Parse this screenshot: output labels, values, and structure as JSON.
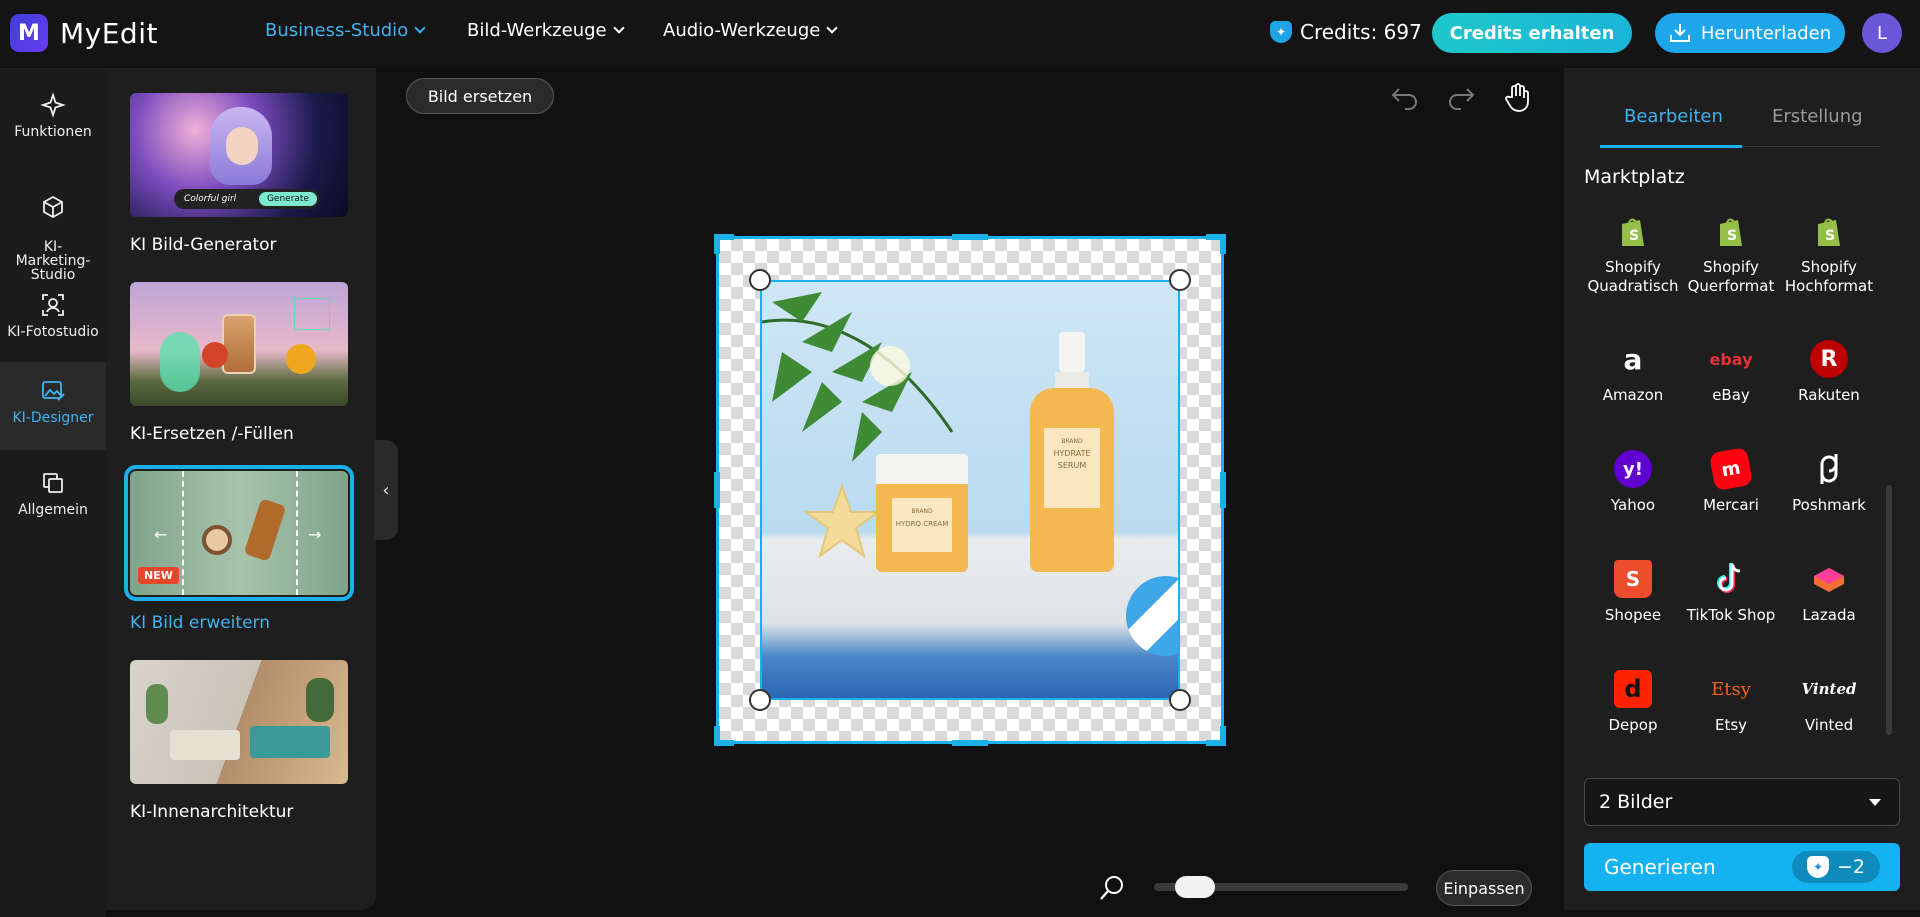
{
  "app": {
    "name": "MyEdit",
    "logo_letter": "M"
  },
  "topnav": [
    {
      "label": "Business-Studio",
      "active": true
    },
    {
      "label": "Bild-Werkzeuge",
      "active": false
    },
    {
      "label": "Audio-Werkzeuge",
      "active": false
    }
  ],
  "header": {
    "credits_label": "Credits: 697",
    "credits_button": "Credits erhalten",
    "download_button": "Herunterladen",
    "avatar_letter": "L"
  },
  "rail": [
    {
      "label": "Funktionen",
      "icon": "sparkle-icon",
      "active": false
    },
    {
      "label": "KI-\nMarketing-\nStudio",
      "icon": "cube-icon",
      "active": false
    },
    {
      "label": "KI-Fotostudio",
      "icon": "portrait-scan-icon",
      "active": false
    },
    {
      "label": "KI-Designer",
      "icon": "image-edit-icon",
      "active": true
    },
    {
      "label": "Allgemein",
      "icon": "layers-icon",
      "active": false
    }
  ],
  "panel_cards": [
    {
      "label": "KI Bild-Generator",
      "overlay_prompt": "Colorful girl",
      "overlay_button": "Generate",
      "active": false
    },
    {
      "label": "KI-Ersetzen /-Füllen",
      "active": false
    },
    {
      "label": "KI Bild erweitern",
      "badge": "NEW",
      "active": true
    },
    {
      "label": "KI-Innenarchitektur",
      "active": false
    }
  ],
  "canvas": {
    "replace_button": "Bild ersetzen",
    "fit_button": "Einpassen",
    "jar_label_brand": "BRAND",
    "jar_label_name": "HYDRO CREAM",
    "bottle_label_brand": "BRAND",
    "bottle_label_name": "HYDRATE SERUM",
    "zoom_level": 0.1
  },
  "right_panel": {
    "tabs": [
      {
        "label": "Bearbeiten",
        "active": true
      },
      {
        "label": "Erstellung",
        "active": false
      }
    ],
    "section_title": "Marktplatz",
    "marketplaces": [
      {
        "label": "Shopify Quadratisch",
        "icon": "shopify-icon",
        "color": "#95bf47"
      },
      {
        "label": "Shopify Querformat",
        "icon": "shopify-icon",
        "color": "#95bf47"
      },
      {
        "label": "Shopify Hochformat",
        "icon": "shopify-icon",
        "color": "#95bf47"
      },
      {
        "label": "Amazon",
        "icon": "amazon-icon",
        "color": "#ffffff"
      },
      {
        "label": "eBay",
        "icon": "ebay-icon",
        "color": "#e53238"
      },
      {
        "label": "Rakuten",
        "icon": "rakuten-icon",
        "color": "#bf0000"
      },
      {
        "label": "Yahoo",
        "icon": "yahoo-icon",
        "color": "#6001d2"
      },
      {
        "label": "Mercari",
        "icon": "mercari-icon",
        "color": "#ff0211"
      },
      {
        "label": "Poshmark",
        "icon": "poshmark-icon",
        "color": "#ffffff"
      },
      {
        "label": "Shopee",
        "icon": "shopee-icon",
        "color": "#ee4d2d"
      },
      {
        "label": "TikTok Shop",
        "icon": "tiktok-icon",
        "color": "#ffffff"
      },
      {
        "label": "Lazada",
        "icon": "lazada-icon",
        "color": "#f36f36"
      },
      {
        "label": "Depop",
        "icon": "depop-icon",
        "color": "#ff2300"
      },
      {
        "label": "Etsy",
        "icon": "etsy-icon",
        "color": "#f1641e"
      },
      {
        "label": "Vinted",
        "icon": "vinted-icon",
        "color": "#ffffff"
      }
    ],
    "marketplace_glyphs": {
      "amazon": "a",
      "ebay": "ebay",
      "rakuten": "R",
      "yahoo": "y!",
      "mercari": "m",
      "shopee": "S",
      "depop": "d",
      "etsy": "Etsy",
      "vinted": "Vinted"
    },
    "image_count_select": "2 Bilder",
    "generate_button": "Generieren",
    "generate_cost": "−2"
  },
  "colors": {
    "accent": "#1ab0ea",
    "credits_button": "#1ec6c9",
    "avatar": "#6a56d8"
  }
}
